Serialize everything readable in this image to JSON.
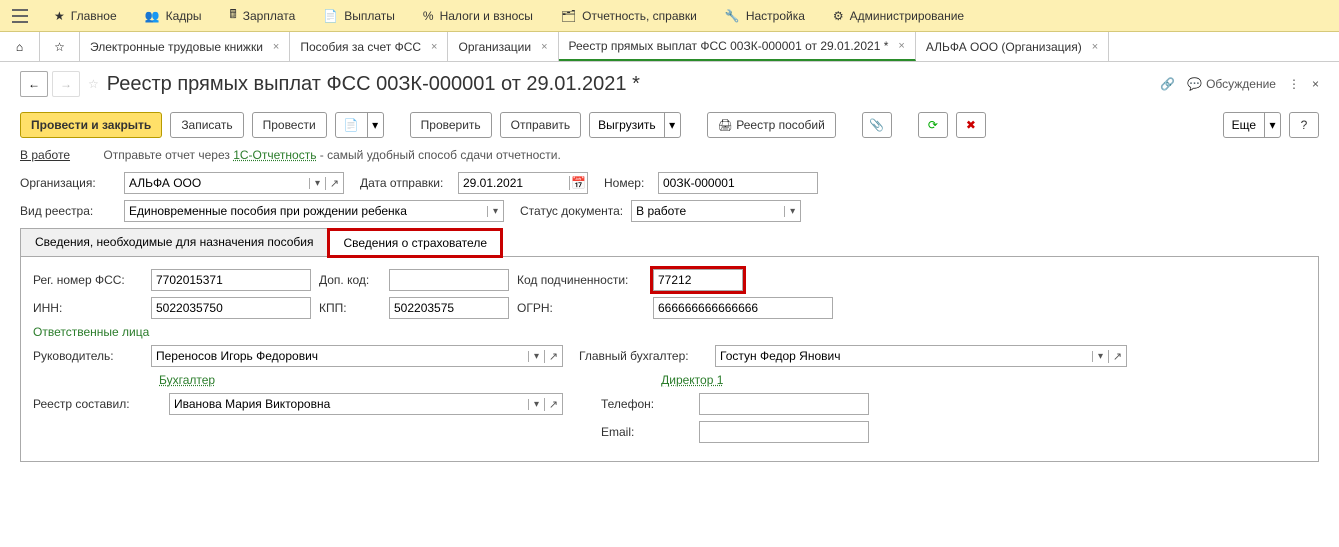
{
  "topmenu": {
    "items": [
      {
        "label": "Главное",
        "icon": "star"
      },
      {
        "label": "Кадры",
        "icon": "people"
      },
      {
        "label": "Зарплата",
        "icon": "calc"
      },
      {
        "label": "Выплаты",
        "icon": "doc"
      },
      {
        "label": "Налоги и взносы",
        "icon": "percent"
      },
      {
        "label": "Отчетность, справки",
        "icon": "report"
      },
      {
        "label": "Настройка",
        "icon": "wrench"
      },
      {
        "label": "Администрирование",
        "icon": "gear"
      }
    ]
  },
  "tabs": [
    {
      "label": "Электронные трудовые книжки",
      "active": false
    },
    {
      "label": "Пособия за счет ФСС",
      "active": false
    },
    {
      "label": "Организации",
      "active": false
    },
    {
      "label": "Реестр прямых выплат ФСС 00ЗК-000001 от 29.01.2021 *",
      "active": true
    },
    {
      "label": "АЛЬФА ООО (Организация)",
      "active": false
    }
  ],
  "title": "Реестр прямых выплат ФСС 00ЗК-000001 от 29.01.2021 *",
  "title_right": {
    "discuss": "Обсуждение"
  },
  "toolbar": {
    "post_close": "Провести и закрыть",
    "write": "Записать",
    "post": "Провести",
    "check": "Проверить",
    "send": "Отправить",
    "export": "Выгрузить",
    "registry": "Реестр пособий",
    "more": "Еще"
  },
  "info": {
    "status": "В работе",
    "prefix": "Отправьте отчет через ",
    "service": "1С-Отчетность",
    "suffix": " - самый удобный способ сдачи отчетности."
  },
  "form": {
    "org_label": "Организация:",
    "org_value": "АЛЬФА ООО",
    "date_label": "Дата отправки:",
    "date_value": "29.01.2021",
    "num_label": "Номер:",
    "num_value": "00ЗК-000001",
    "kind_label": "Вид реестра:",
    "kind_value": "Единовременные пособия при рождении ребенка",
    "status_label": "Статус документа:",
    "status_value": "В работе"
  },
  "innertabs": {
    "t1": "Сведения, необходимые для назначения пособия",
    "t2": "Сведения о страхователе"
  },
  "insurer": {
    "reg_label": "Рег. номер ФСС:",
    "reg_value": "7702015371",
    "dop_label": "Доп. код:",
    "dop_value": "",
    "kod_label": "Код подчиненности:",
    "kod_value": "77212",
    "inn_label": "ИНН:",
    "inn_value": "5022035750",
    "kpp_label": "КПП:",
    "kpp_value": "502203575",
    "ogrn_label": "ОГРН:",
    "ogrn_value": "666666666666666",
    "resp_h": "Ответственные лица",
    "dir_label": "Руководитель:",
    "dir_value": "Переносов Игорь Федорович",
    "glb_label": "Главный бухгалтер:",
    "glb_value": "Гостун Федор Янович",
    "add_buh": "Бухгалтер ",
    "add_dir": "Директор 1 ",
    "comp_label": "Реестр составил:",
    "comp_value": "Иванова Мария Викторовна",
    "phone_label": "Телефон:",
    "phone_value": "",
    "email_label": "Email:",
    "email_value": ""
  }
}
